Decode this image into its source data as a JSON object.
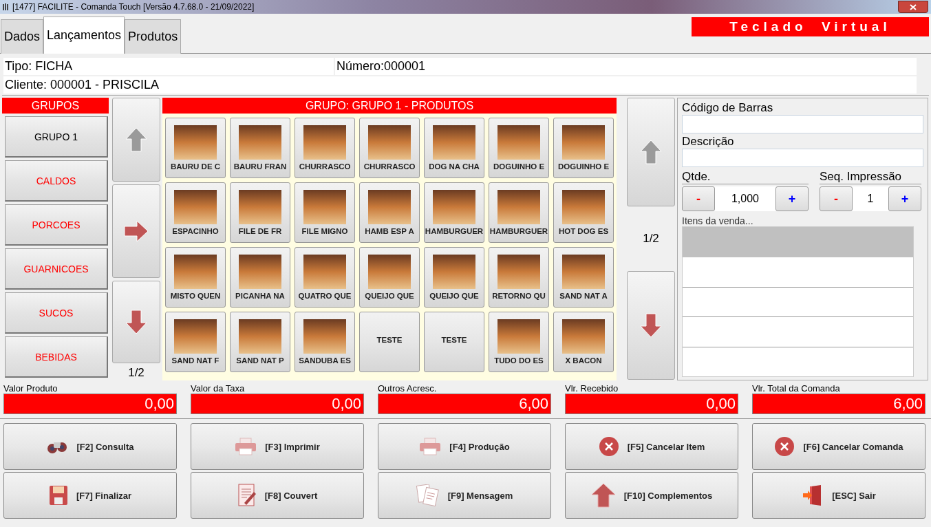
{
  "window": {
    "title": "[1477] FACILITE - Comanda Touch [Versão 4.7.68.0 - 21/09/2022]"
  },
  "tabs": [
    {
      "label": "Dados",
      "selected": false
    },
    {
      "label": "Lançamentos",
      "selected": true
    },
    {
      "label": "Produtos",
      "selected": false
    }
  ],
  "virtual_keyboard_button": "Teclado Virtual",
  "info": {
    "tipo": "Tipo: FICHA",
    "numero": "Número:000001",
    "cliente": "Cliente: 000001 - PRISCILA"
  },
  "groups": {
    "title": "GRUPOS",
    "page": "1/2",
    "items": [
      {
        "label": "GRUPO 1",
        "selected": true
      },
      {
        "label": "CALDOS",
        "selected": false
      },
      {
        "label": "PORCOES",
        "selected": false
      },
      {
        "label": "GUARNICOES",
        "selected": false
      },
      {
        "label": "SUCOS",
        "selected": false
      },
      {
        "label": "BEBIDAS",
        "selected": false
      }
    ]
  },
  "products": {
    "title": "GRUPO: GRUPO 1 - PRODUTOS",
    "page": "1/2",
    "items": [
      {
        "label": "BAURU DE C",
        "kind": "photo"
      },
      {
        "label": "BAURU FRAN",
        "kind": "photo"
      },
      {
        "label": "CHURRASCO",
        "kind": "photo"
      },
      {
        "label": "CHURRASCO",
        "kind": "photo"
      },
      {
        "label": "DOG NA CHA",
        "kind": "photo"
      },
      {
        "label": "DOGUINHO E",
        "kind": "photo"
      },
      {
        "label": "DOGUINHO E",
        "kind": "photo"
      },
      {
        "label": "ESPACINHO",
        "kind": "photo"
      },
      {
        "label": "FILE DE FR",
        "kind": "photo"
      },
      {
        "label": "FILE MIGNO",
        "kind": "photo"
      },
      {
        "label": "HAMB ESP A",
        "kind": "photo"
      },
      {
        "label": "HAMBURGUER",
        "kind": "photo"
      },
      {
        "label": "HAMBURGUER",
        "kind": "photo"
      },
      {
        "label": "HOT DOG ES",
        "kind": "photo"
      },
      {
        "label": "MISTO QUEN",
        "kind": "photo"
      },
      {
        "label": "PICANHA NA",
        "kind": "photo"
      },
      {
        "label": "QUATRO QUE",
        "kind": "photo"
      },
      {
        "label": "QUEIJO QUE",
        "kind": "photo"
      },
      {
        "label": "QUEIJO QUE",
        "kind": "photo"
      },
      {
        "label": "RETORNO QU",
        "kind": "photo"
      },
      {
        "label": "SAND NAT A",
        "kind": "photo"
      },
      {
        "label": "SAND NAT F",
        "kind": "photo"
      },
      {
        "label": "SAND NAT P",
        "kind": "photo"
      },
      {
        "label": "SANDUBA ES",
        "kind": "photo"
      },
      {
        "label": "TESTE",
        "kind": "text"
      },
      {
        "label": "TESTE",
        "kind": "text"
      },
      {
        "label": "TUDO DO ES",
        "kind": "photo"
      },
      {
        "label": "X BACON",
        "kind": "photo"
      }
    ]
  },
  "entry": {
    "barcode_label": "Código de Barras",
    "description_label": "Descrição",
    "qty": {
      "label": "Qtde.",
      "value": "1,000",
      "minus": "-",
      "plus": "+"
    },
    "seq": {
      "label": "Seq. Impressão",
      "value": "1",
      "minus": "-",
      "plus": "+"
    },
    "items_title": "Itens da venda..."
  },
  "totals": [
    {
      "label": "Valor Produto",
      "value": "0,00"
    },
    {
      "label": "Valor da Taxa",
      "value": "0,00"
    },
    {
      "label": "Outros Acresc.",
      "value": "6,00"
    },
    {
      "label": "Vlr. Recebido",
      "value": "0,00"
    },
    {
      "label": "Vlr. Total da Comanda",
      "value": "6,00"
    }
  ],
  "actions": [
    {
      "label": "[F2] Consulta"
    },
    {
      "label": "[F3] Imprimir"
    },
    {
      "label": "[F4] Produção"
    },
    {
      "label": "[F5] Cancelar Item"
    },
    {
      "label": "[F6] Cancelar Comanda"
    },
    {
      "label": "[F7] Finalizar"
    },
    {
      "label": "[F8] Couvert"
    },
    {
      "label": "[F9] Mensagem"
    },
    {
      "label": "[F10] Complementos"
    },
    {
      "label": "[ESC] Sair"
    }
  ]
}
